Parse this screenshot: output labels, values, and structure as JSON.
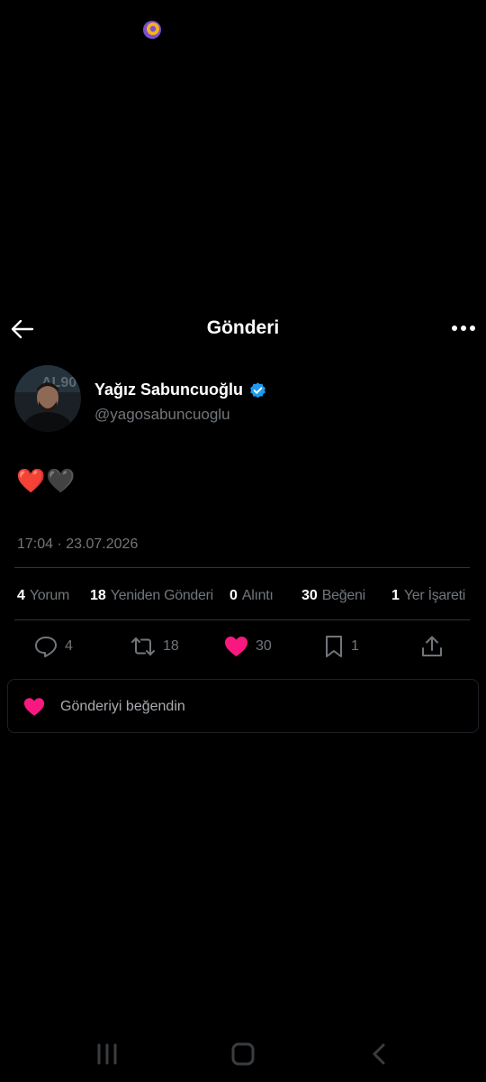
{
  "status_bar": {
    "icon": "app-badge-icon"
  },
  "header": {
    "title": "Gönderi",
    "back_icon": "arrow-left-icon",
    "more_icon": "more-horizontal-icon"
  },
  "author": {
    "name": "Yağız Sabuncuoğlu",
    "handle": "@yagosabuncuoglu",
    "verified": true
  },
  "tweet": {
    "text": "❤️🖤",
    "time": "17:04",
    "date": "23.07.2026",
    "timestamp": "17:04 · 23.07.2026"
  },
  "stats": [
    {
      "count": "4",
      "label": "Yorum"
    },
    {
      "count": "18",
      "label": "Yeniden Gönderi"
    },
    {
      "count": "0",
      "label": "Alıntı"
    },
    {
      "count": "30",
      "label": "Beğeni"
    },
    {
      "count": "1",
      "label": "Yer İşareti"
    }
  ],
  "actions": {
    "reply": {
      "icon": "reply-icon",
      "count": "4"
    },
    "retweet": {
      "icon": "retweet-icon",
      "count": "18"
    },
    "like": {
      "icon": "heart-filled-icon",
      "count": "30",
      "color": "#f91880"
    },
    "bookmark": {
      "icon": "bookmark-icon",
      "count": "1"
    },
    "share": {
      "icon": "share-icon"
    }
  },
  "liked_notice": {
    "text": "Gönderiyi beğendin"
  },
  "colors": {
    "background": "#000000",
    "muted": "#71767b",
    "like": "#f91880",
    "verified": "#1d9bf0"
  },
  "system_nav": {
    "recents": "recents-icon",
    "home": "home-icon",
    "back": "back-chevron-icon"
  }
}
